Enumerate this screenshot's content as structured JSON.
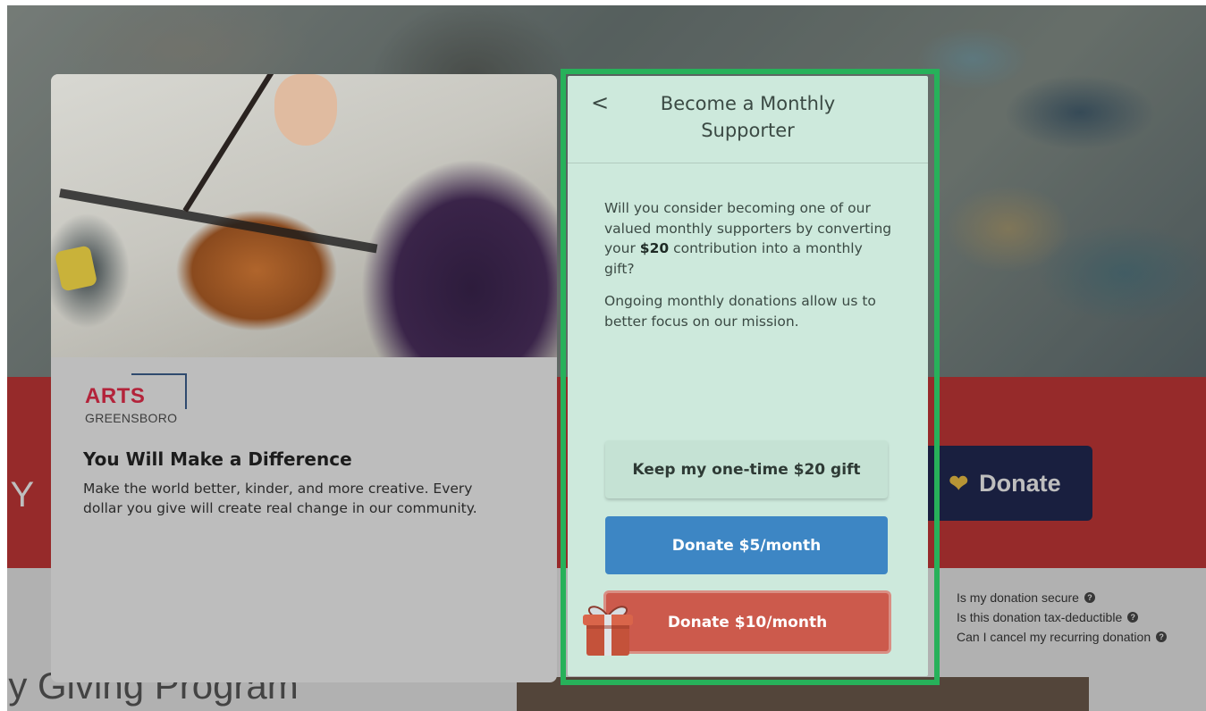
{
  "background": {
    "headline_fragment": "t Y",
    "donate_button": {
      "label": "Donate",
      "icon": "heart-icon"
    },
    "faq": [
      {
        "label": "Is my donation secure",
        "icon": "question-icon"
      },
      {
        "label": "Is this donation tax-deductible",
        "icon": "question-icon"
      },
      {
        "label": "Can I cancel my recurring donation",
        "icon": "question-icon"
      }
    ],
    "program_heading": "ly Giving Program"
  },
  "info_card": {
    "logo": {
      "top": "ARTS",
      "bottom": "GREENSBORO"
    },
    "title": "You Will Make a Difference",
    "description": "Make the world better, kinder, and more creative. Every dollar you give will create real change in our community."
  },
  "modal": {
    "back_icon": "chevron-left-icon",
    "back_glyph": "<",
    "title": "Become a Monthly Supporter",
    "copy": {
      "p1_before": "Will you consider becoming one of our valued monthly supporters by converting your ",
      "p1_amount": "$20",
      "p1_after": " contribution into a monthly gift?",
      "p2": "Ongoing monthly donations allow us to better focus on our mission."
    },
    "buttons": {
      "keep": "Keep my one-time $20 gift",
      "five": "Donate $5/month",
      "ten": "Donate $10/month"
    },
    "gift_icon": "gift-icon"
  },
  "colors": {
    "modal_bg": "#cde9dc",
    "highlight_outline": "#27b15a",
    "donate5": "#3d86c4",
    "donate10": "#cc5a4c",
    "brand_red": "#c83232",
    "brand_navy": "#1b2350"
  }
}
